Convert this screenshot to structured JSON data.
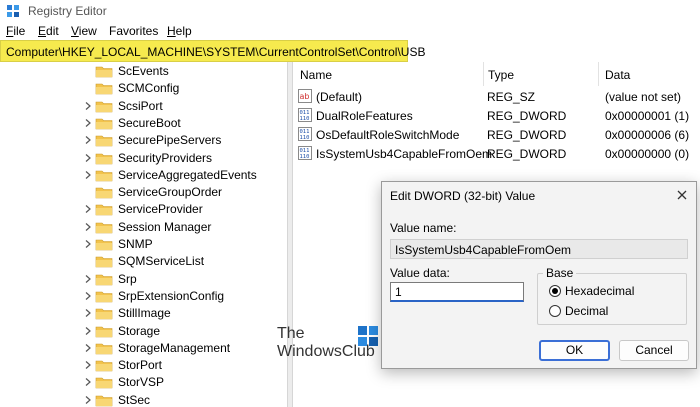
{
  "window": {
    "title": "Registry Editor"
  },
  "menu": [
    {
      "key": "F",
      "rest": "ile"
    },
    {
      "key": "E",
      "rest": "dit"
    },
    {
      "key": "V",
      "rest": "iew"
    },
    {
      "key": "",
      "rest": "Favorites"
    },
    {
      "key": "H",
      "rest": "elp"
    }
  ],
  "address": {
    "path": "Computer\\HKEY_LOCAL_MACHINE\\SYSTEM\\CurrentControlSet\\Control\\USB"
  },
  "tree": {
    "items": [
      {
        "label": "ScEvents",
        "expandable": false
      },
      {
        "label": "SCMConfig",
        "expandable": false
      },
      {
        "label": "ScsiPort",
        "expandable": true
      },
      {
        "label": "SecureBoot",
        "expandable": true
      },
      {
        "label": "SecurePipeServers",
        "expandable": true
      },
      {
        "label": "SecurityProviders",
        "expandable": true
      },
      {
        "label": "ServiceAggregatedEvents",
        "expandable": true
      },
      {
        "label": "ServiceGroupOrder",
        "expandable": false
      },
      {
        "label": "ServiceProvider",
        "expandable": true
      },
      {
        "label": "Session Manager",
        "expandable": true
      },
      {
        "label": "SNMP",
        "expandable": true
      },
      {
        "label": "SQMServiceList",
        "expandable": false
      },
      {
        "label": "Srp",
        "expandable": true
      },
      {
        "label": "SrpExtensionConfig",
        "expandable": true
      },
      {
        "label": "StillImage",
        "expandable": true
      },
      {
        "label": "Storage",
        "expandable": true
      },
      {
        "label": "StorageManagement",
        "expandable": true
      },
      {
        "label": "StorPort",
        "expandable": true
      },
      {
        "label": "StorVSP",
        "expandable": true
      },
      {
        "label": "StSec",
        "expandable": true
      }
    ]
  },
  "values_pane": {
    "columns": {
      "name": "Data",
      "name_col": "Name",
      "type_col": "Type",
      "data_col": "Data"
    },
    "rows": [
      {
        "icon": "string-value-icon",
        "name": "(Default)",
        "type": "REG_SZ",
        "data": "(value not set)"
      },
      {
        "icon": "dword-value-icon",
        "name": "DualRoleFeatures",
        "type": "REG_DWORD",
        "data": "0x00000001 (1)"
      },
      {
        "icon": "dword-value-icon",
        "name": "OsDefaultRoleSwitchMode",
        "type": "REG_DWORD",
        "data": "0x00000006 (6)"
      },
      {
        "icon": "dword-value-icon",
        "name": "IsSystemUsb4CapableFromOem",
        "type": "REG_DWORD",
        "data": "0x00000000 (0)"
      }
    ]
  },
  "watermark": {
    "line1": "The",
    "line2": "WindowsClub"
  },
  "dialog": {
    "title": "Edit DWORD (32-bit) Value",
    "value_name_label": "Value name:",
    "value_name": "IsSystemUsb4CapableFromOem",
    "value_data_label": "Value data:",
    "value_data": "1",
    "base_label": "Base",
    "hex_label": "Hexadecimal",
    "dec_label": "Decimal",
    "selected_base": "Hexadecimal",
    "ok_label": "OK",
    "cancel_label": "Cancel"
  },
  "colors": {
    "address_highlight": "#f6ea4e",
    "folder": "#f2c34c",
    "accent": "#3b6fd6"
  }
}
